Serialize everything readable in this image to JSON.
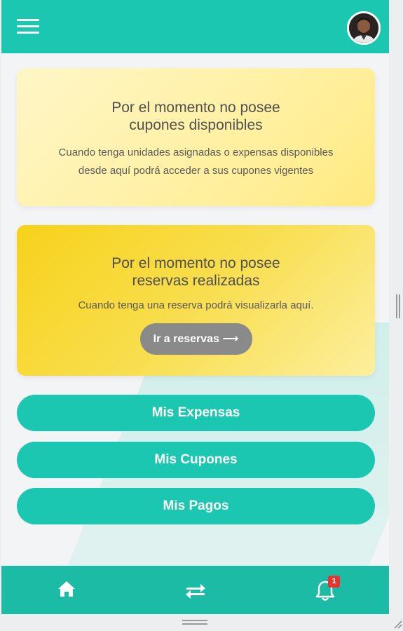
{
  "header": {
    "menu_icon": "hamburger-menu-icon",
    "avatar": "user-avatar-photo"
  },
  "cupones_card": {
    "title_line1": "Por el momento no posee",
    "title_line2": "cupones disponibles",
    "desc_line1": "Cuando tenga unidades asignadas o expensas disponibles",
    "desc_line2": "desde aquí podrá acceder a sus cupones vigentes"
  },
  "reservas_card": {
    "title_line1": "Por el momento no posee",
    "title_line2": "reservas realizadas",
    "desc": "Cuando tenga una reserva podrá visualizarla aquí.",
    "button_label": "Ir a reservas ⟶"
  },
  "actions": {
    "expensas": "Mis Expensas",
    "cupones": "Mis Cupones",
    "pagos": "Mis Pagos"
  },
  "bottom_nav": {
    "home_icon": "home-icon",
    "transfer_icon": "transfer-arrows-icon",
    "bell_icon": "bell-icon",
    "notification_count": "1"
  },
  "colors": {
    "primary": "#1cc7b1",
    "bottom_bar": "#1bbba6",
    "card_light": "#fff3b0",
    "card_yellow": "#f7d21b",
    "button_gray": "#8a8a8a",
    "badge_red": "#e8332f"
  }
}
